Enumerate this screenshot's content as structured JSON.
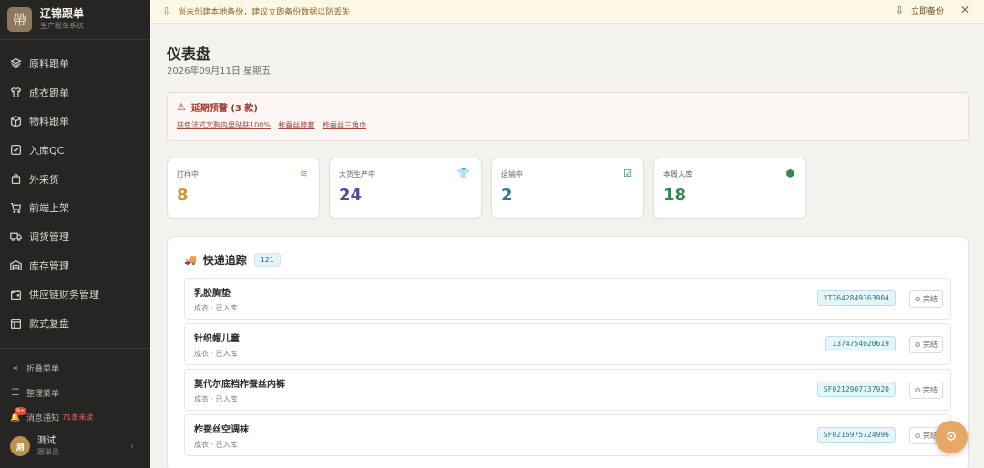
{
  "sidebar": {
    "brand_title": "辽锦跟单",
    "brand_sub": "生产跟单系统",
    "logo_glyph": "帶",
    "items": [
      {
        "label": "原料跟单",
        "icon": "layers-icon"
      },
      {
        "label": "成衣跟单",
        "icon": "shirt-icon"
      },
      {
        "label": "物料跟单",
        "icon": "box-icon"
      },
      {
        "label": "入库QC",
        "icon": "checkbox-icon"
      },
      {
        "label": "外采货",
        "icon": "bag-icon"
      },
      {
        "label": "前端上架",
        "icon": "cart-icon"
      },
      {
        "label": "调货管理",
        "icon": "truck-icon"
      },
      {
        "label": "库存管理",
        "icon": "warehouse-icon"
      },
      {
        "label": "供应链财务管理",
        "icon": "wallet-icon"
      },
      {
        "label": "款式复盘",
        "icon": "grid-icon"
      }
    ],
    "collapse_label": "折叠菜单",
    "arrange_label": "整理菜单",
    "notify_label": "消息通知",
    "notify_badge": "9+",
    "notify_unread": "71条未读",
    "user_name": "测试",
    "user_role": "跟单员",
    "user_avatar": "测"
  },
  "banner": {
    "text": "尚未创建本地备份，建议立即备份数据以防丢失",
    "action": "立即备份",
    "close": "✕"
  },
  "main": {
    "title": "仪表盘",
    "date": "2026年09月11日 星期五"
  },
  "alert": {
    "title": "延期预警 (3 款)",
    "links": [
      "肤色法式文胸内里贴肤100%",
      "柞蚕丝脖套",
      "柞蚕丝三角巾"
    ]
  },
  "stats": [
    {
      "label": "打样中",
      "value": "8",
      "color": "#c99a2e",
      "icon": "layers-icon",
      "glyph": "≋"
    },
    {
      "label": "大货生产中",
      "value": "24",
      "color": "#4a4fa0",
      "icon": "shirt-icon",
      "glyph": "👕"
    },
    {
      "label": "运输中",
      "value": "2",
      "color": "#2f7c8a",
      "icon": "checkbox-icon",
      "glyph": "☑"
    },
    {
      "label": "本周入库",
      "value": "18",
      "color": "#2f8a4f",
      "icon": "box-icon",
      "glyph": "⬢"
    }
  ],
  "tracking": {
    "title": "快递追踪",
    "count": "121",
    "rows": [
      {
        "name": "乳胶胸垫",
        "status": "成衣 · 已入库",
        "tracking": "YT7642849363904",
        "action": "完结"
      },
      {
        "name": "针织帽儿童",
        "status": "成衣 · 已入库",
        "tracking": "1374754020619",
        "action": "完结"
      },
      {
        "name": "莫代尔底裆柞蚕丝内裤",
        "status": "成衣 · 已入库",
        "tracking": "SF0212907737920",
        "action": "完结"
      },
      {
        "name": "柞蚕丝空调袜",
        "status": "成衣 · 已入库",
        "tracking": "SF0216975724996",
        "action": "完结"
      }
    ]
  }
}
